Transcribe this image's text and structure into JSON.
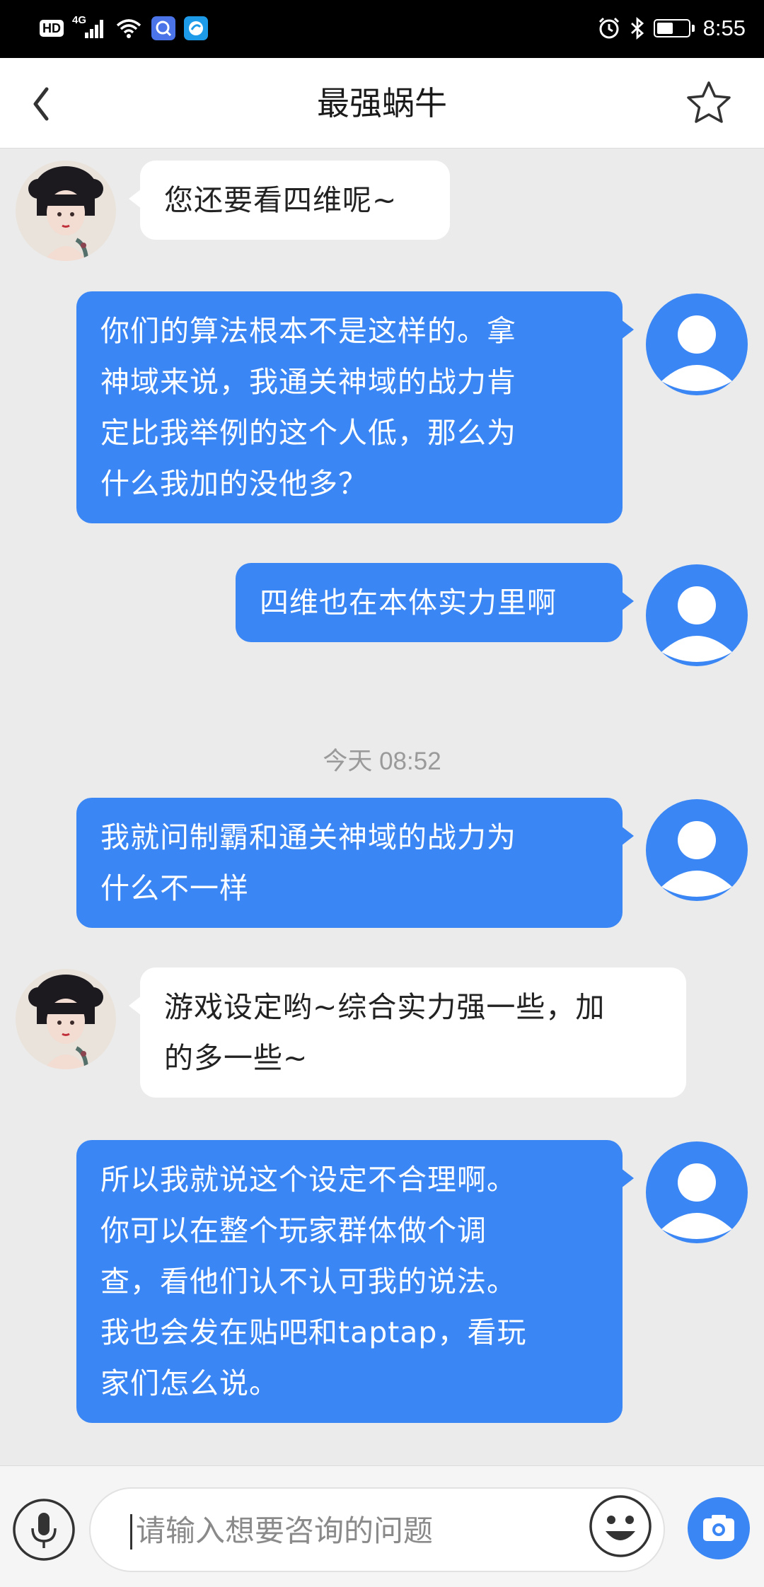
{
  "status_bar": {
    "hd_badge": "HD",
    "network_label": "4G",
    "time": "8:55"
  },
  "navbar": {
    "title": "最强蜗牛"
  },
  "messages": [
    {
      "from": "bot",
      "text": "您还要看四维呢~"
    },
    {
      "from": "user",
      "text": "你们的算法根本不是这样的。拿\n神域来说，我通关神域的战力肯\n定比我举例的这个人低，那么为\n什么我加的没他多？"
    },
    {
      "from": "user",
      "text": "四维也在本体实力里啊"
    },
    {
      "timestamp": "今天 08:52"
    },
    {
      "from": "user",
      "text": "我就问制霸和通关神域的战力为\n什么不一样"
    },
    {
      "from": "bot",
      "text": "游戏设定哟~综合实力强一些，加\n的多一些~"
    },
    {
      "from": "user",
      "text": "所以我就说这个设定不合理啊。\n你可以在整个玩家群体做个调\n查，看他们认不认可我的说法。\n我也会发在贴吧和taptap，看玩\n家们怎么说。"
    }
  ],
  "input": {
    "placeholder": "请输入想要咨询的问题"
  },
  "colors": {
    "user_bubble": "#3a86f5",
    "bot_bubble": "#ffffff",
    "background": "#ebebeb"
  },
  "icons": [
    "back-chevron-icon",
    "star-icon",
    "microphone-icon",
    "emoji-icon",
    "camera-icon",
    "user-avatar-icon"
  ]
}
